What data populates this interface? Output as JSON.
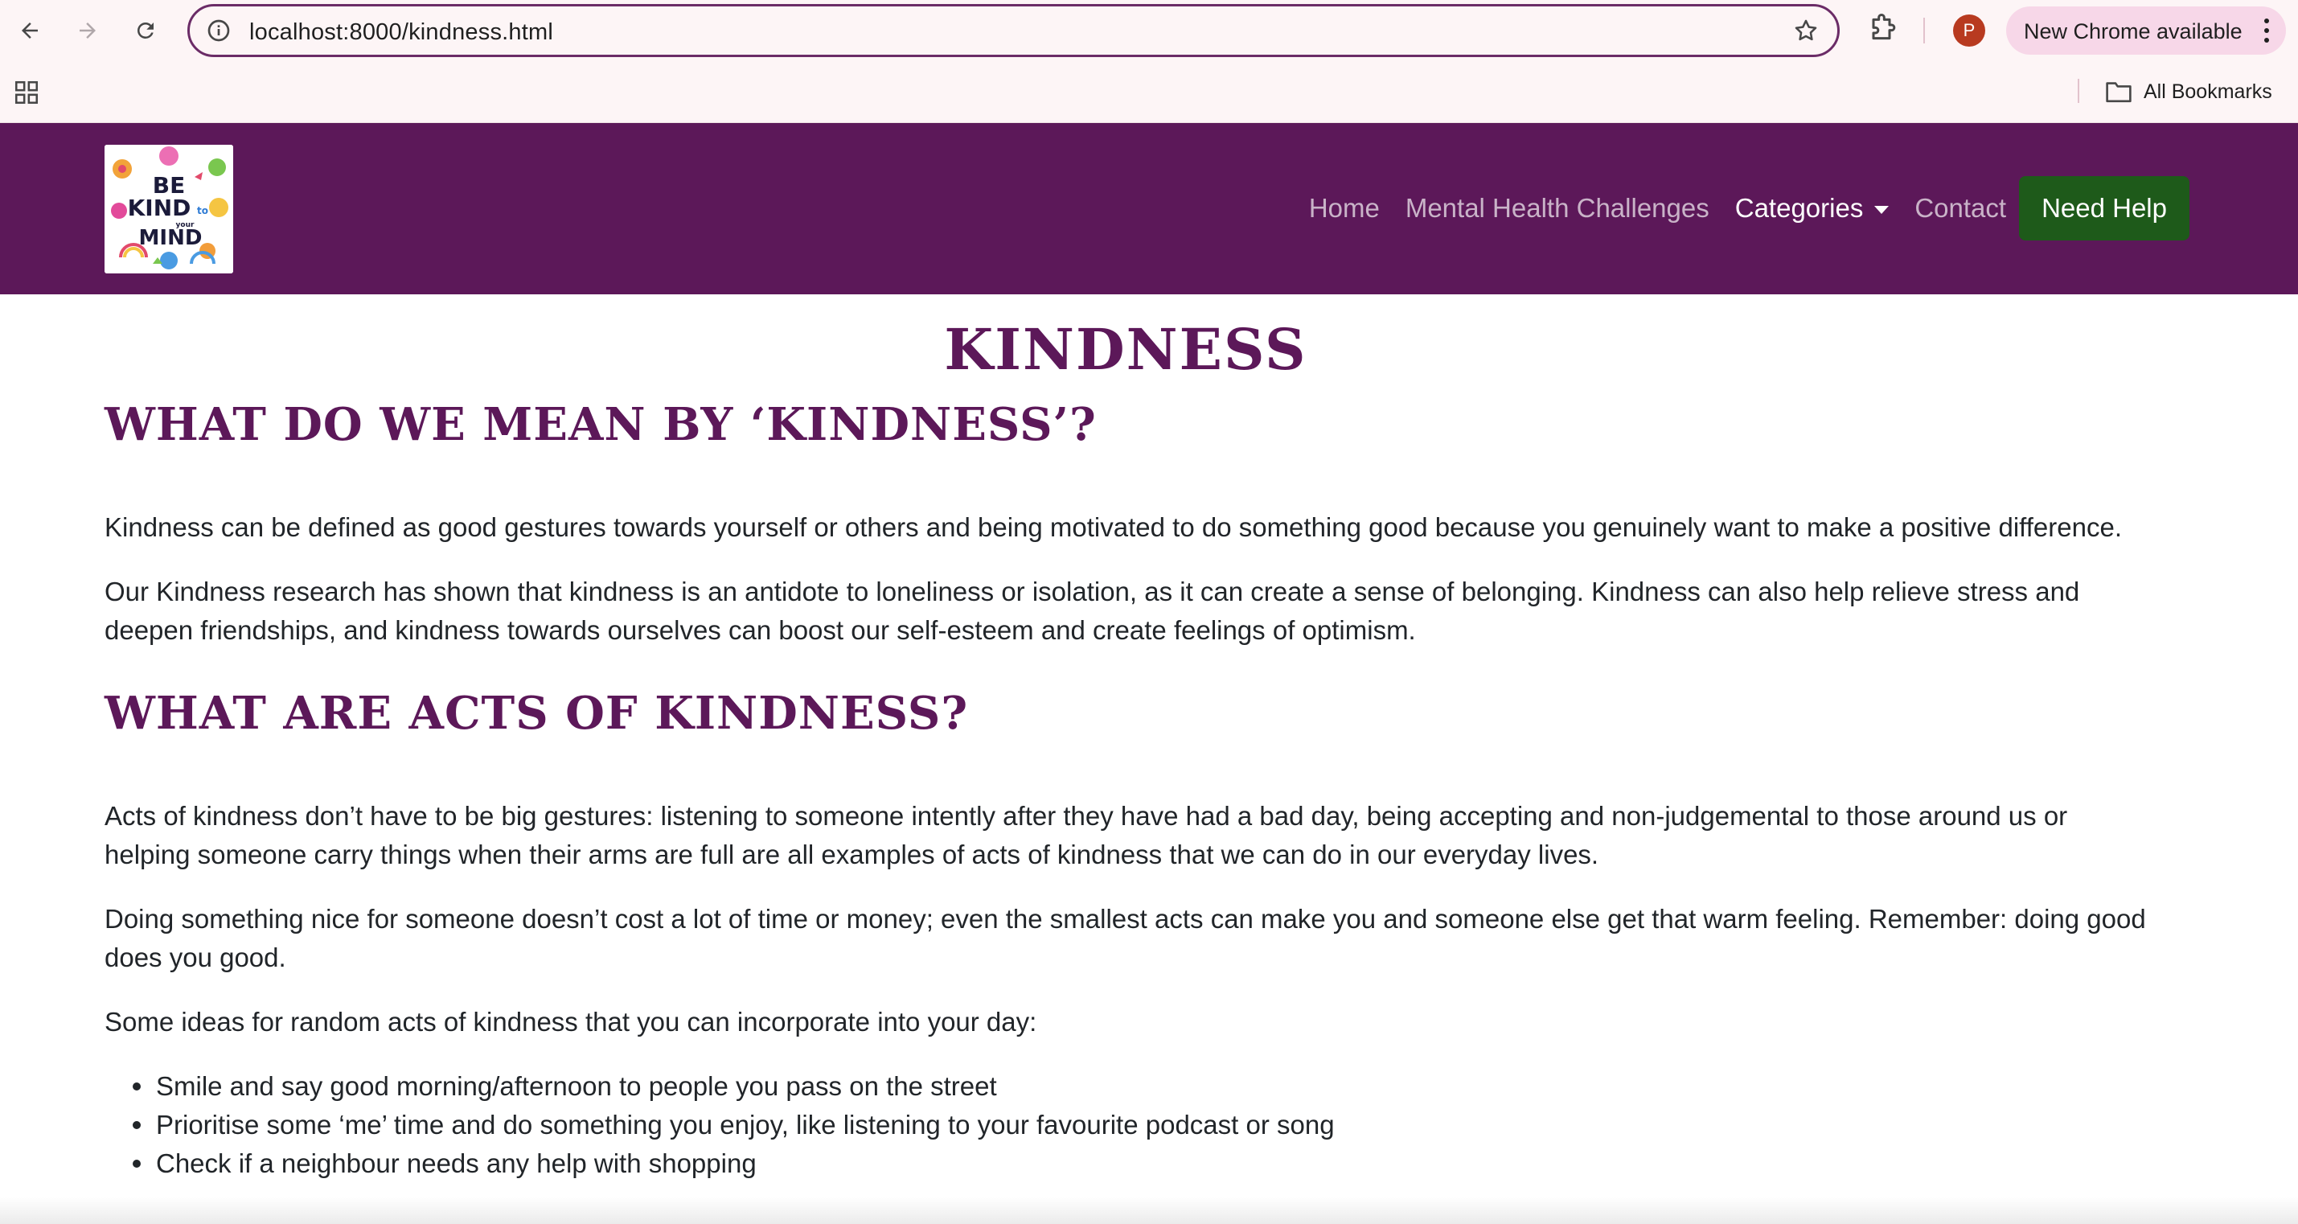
{
  "browser": {
    "url": "localhost:8000/kindness.html",
    "profile_initial": "P",
    "update_label": "New Chrome available",
    "bookmarks_label": "All Bookmarks"
  },
  "site": {
    "brand_color": "#5c1859",
    "help_color": "#1e5a1a",
    "logo_text": [
      "BE",
      "KIND",
      "to",
      "your",
      "MIND"
    ],
    "nav": {
      "home": "Home",
      "challenges": "Mental Health Challenges",
      "categories": "Categories",
      "contact": "Contact",
      "help": "Need Help"
    }
  },
  "page": {
    "title": "KINDNESS",
    "section1": {
      "heading": "WHAT DO WE MEAN BY ‘KINDNESS’?",
      "p1": "Kindness can be defined as good gestures towards yourself or others and being motivated to do something good because you genuinely want to make a positive difference.",
      "p2": "Our Kindness research has shown that kindness is an antidote to loneliness or isolation, as it can create a sense of belonging. Kindness can also help relieve stress and deepen friendships, and kindness towards ourselves can boost our self-esteem and create feelings of optimism."
    },
    "section2": {
      "heading": "WHAT ARE ACTS OF KINDNESS?",
      "p1": "Acts of kindness don’t have to be big gestures: listening to someone intently after they have had a bad day, being accepting and non-judgemental to those around us or helping someone carry things when their arms are full are all examples of acts of kindness that we can do in our everyday lives.",
      "p2": "Doing something nice for someone doesn’t cost a lot of time or money; even the smallest acts can make you and someone else get that warm feeling. Remember: doing good does you good.",
      "p3": "Some ideas for random acts of kindness that you can incorporate into your day:",
      "ideas": [
        "Smile and say good morning/afternoon to people you pass on the street",
        "Prioritise some ‘me’ time and do something you enjoy, like listening to your favourite podcast or song",
        "Check if a neighbour needs any help with shopping"
      ]
    }
  }
}
